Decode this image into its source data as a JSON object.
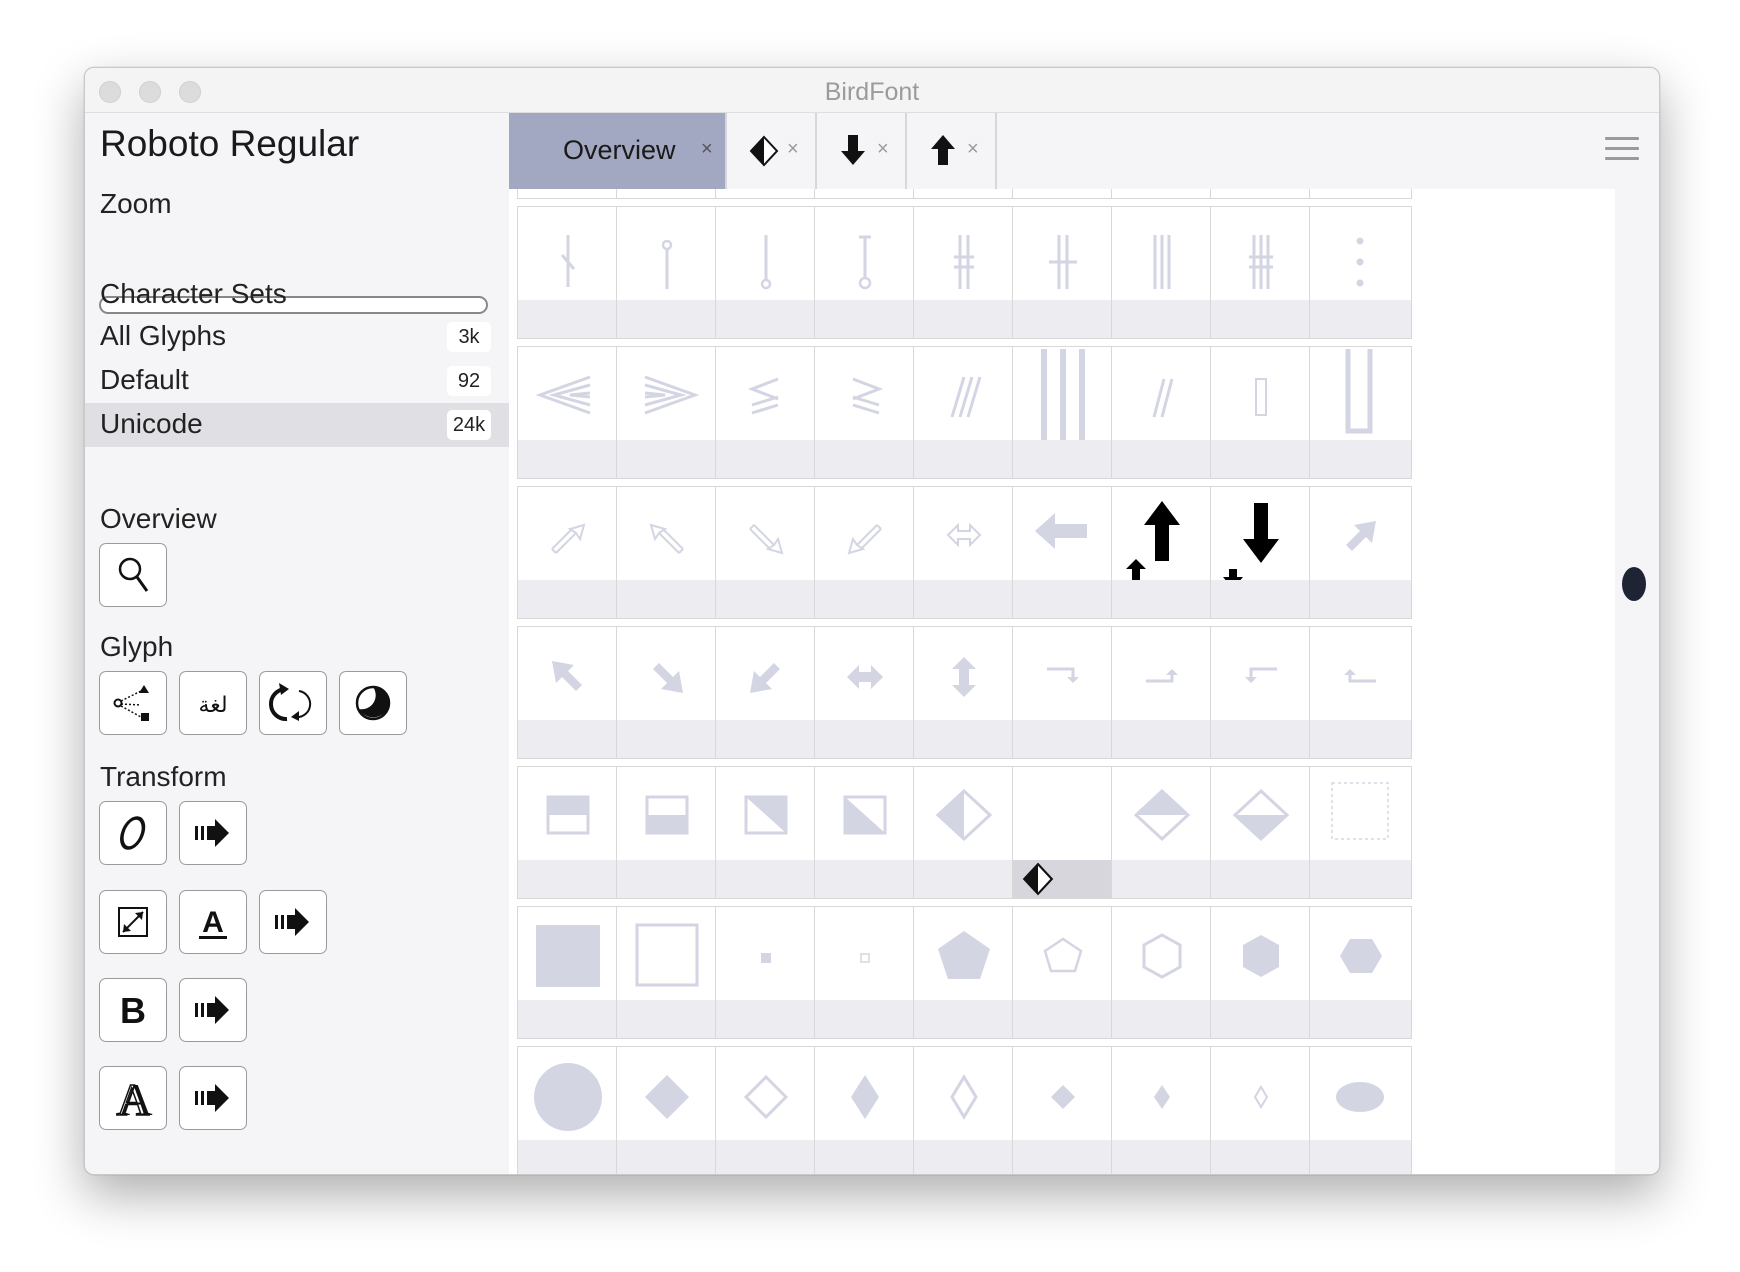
{
  "window": {
    "title": "BirdFont"
  },
  "sidebar": {
    "font_name": "Roboto Regular",
    "zoom_label": "Zoom",
    "character_sets_label": "Character Sets",
    "character_sets": [
      {
        "label": "All Glyphs",
        "count": "3k",
        "selected": false
      },
      {
        "label": "Default",
        "count": "92",
        "selected": false
      },
      {
        "label": "Unicode",
        "count": "24k",
        "selected": true
      }
    ],
    "overview_label": "Overview",
    "glyph_label": "Glyph",
    "transform_label": "Transform",
    "tools": {
      "overview": [
        "search-icon"
      ],
      "glyph": [
        "node-tree-icon",
        "arabic-text-icon",
        "rotate-icon",
        "half-circle-icon"
      ],
      "transform": [
        [
          "italic-icon",
          "apply-arrow-icon"
        ],
        [
          "resize-icon",
          "underline-a-icon",
          "apply-arrow-icon"
        ],
        [
          "bold-icon",
          "apply-arrow-icon"
        ],
        [
          "outline-a-icon",
          "apply-arrow-icon"
        ]
      ]
    }
  },
  "tabs": [
    {
      "label": "Overview",
      "active": true,
      "close": "×"
    },
    {
      "label": "",
      "icon": "diamond-half-icon",
      "close": "×"
    },
    {
      "label": "",
      "icon": "arrow-down-icon",
      "close": "×"
    },
    {
      "label": "",
      "icon": "arrow-up-icon",
      "close": "×"
    }
  ],
  "grid": {
    "rows": [
      [
        "broken-bar",
        "pin",
        "pin-down",
        "i-beam-ring",
        "double-cross-bar",
        "double-cross-bar-wide",
        "triple-bar",
        "triple-cross-bar",
        "vertical-ellipsis"
      ],
      [
        "triple-left-angle",
        "triple-right-angle",
        "triple-less-equal",
        "triple-greater-equal",
        "triple-slash",
        "triple-tall-bar",
        "double-slash",
        "tall-rectangle",
        "tall-bracket"
      ],
      [
        "outline-arrow-ne",
        "outline-arrow-nw",
        "outline-arrow-se",
        "outline-arrow-sw",
        "outline-arrow-lr",
        "heavy-arrow-left",
        "heavy-arrow-up",
        "heavy-arrow-down",
        "arrow-ne"
      ],
      [
        "arrow-nw",
        "arrow-se",
        "arrow-sw",
        "arrow-lr",
        "arrow-ud",
        "hook-right-down",
        "hook-right-up",
        "hook-left-down",
        "hook-left-up"
      ],
      [
        "square-top-half",
        "square-bottom-half",
        "square-upper-right",
        "square-lower-right",
        "diamond-left-half",
        "diamond-half-selected",
        "diamond-top-half",
        "diamond-bottom-half",
        "dotted-square"
      ],
      [
        "filled-square",
        "outline-square",
        "small-filled-square",
        "small-outline-square",
        "filled-pentagon",
        "outline-pentagon",
        "outline-hexagon",
        "filled-hexagon",
        "filled-horizontal-hexagon"
      ],
      [
        "filled-circle",
        "filled-diamond",
        "outline-diamond",
        "filled-lozenge",
        "outline-lozenge",
        "small-filled-diamond",
        "small-filled-lozenge",
        "small-outline-lozenge",
        "filled-ellipse"
      ]
    ]
  },
  "colors": {
    "glyph_light": "#d3d5e3",
    "glyph_dark": "#000000",
    "tab_active": "#a2a7c2",
    "selected_row": "#dfdfe4",
    "scroll_thumb": "#1f2435"
  }
}
